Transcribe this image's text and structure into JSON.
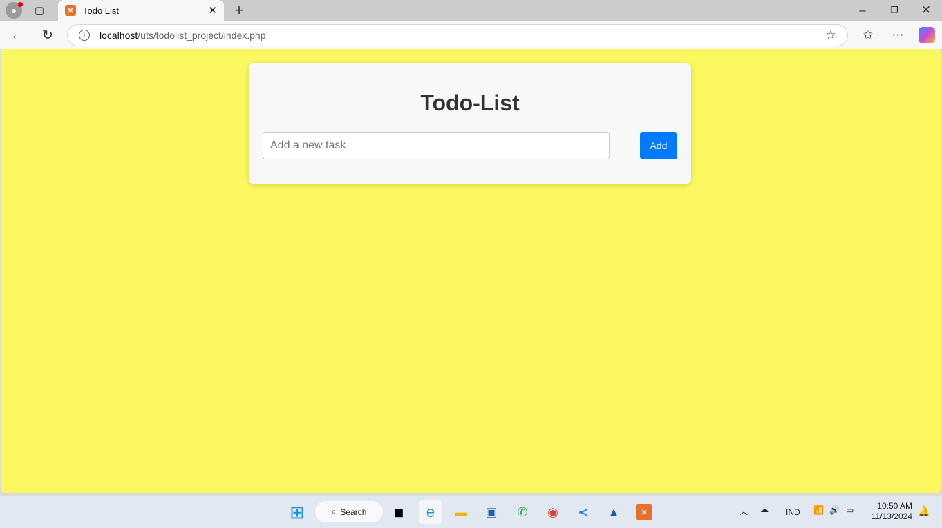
{
  "browser": {
    "tab_title": "Todo List",
    "url_host": "localhost",
    "url_path": "/uts/todolist_project/index.php"
  },
  "app": {
    "title": "Todo-List",
    "input_placeholder": "Add a new task",
    "input_value": "",
    "add_label": "Add",
    "colors": {
      "page_bg": "#fbf85f",
      "card_bg": "#f8f8f8",
      "button": "#007bff"
    }
  },
  "taskbar": {
    "search_label": "Search",
    "language": "IND",
    "time": "10:50 AM",
    "date": "11/13/2024"
  }
}
